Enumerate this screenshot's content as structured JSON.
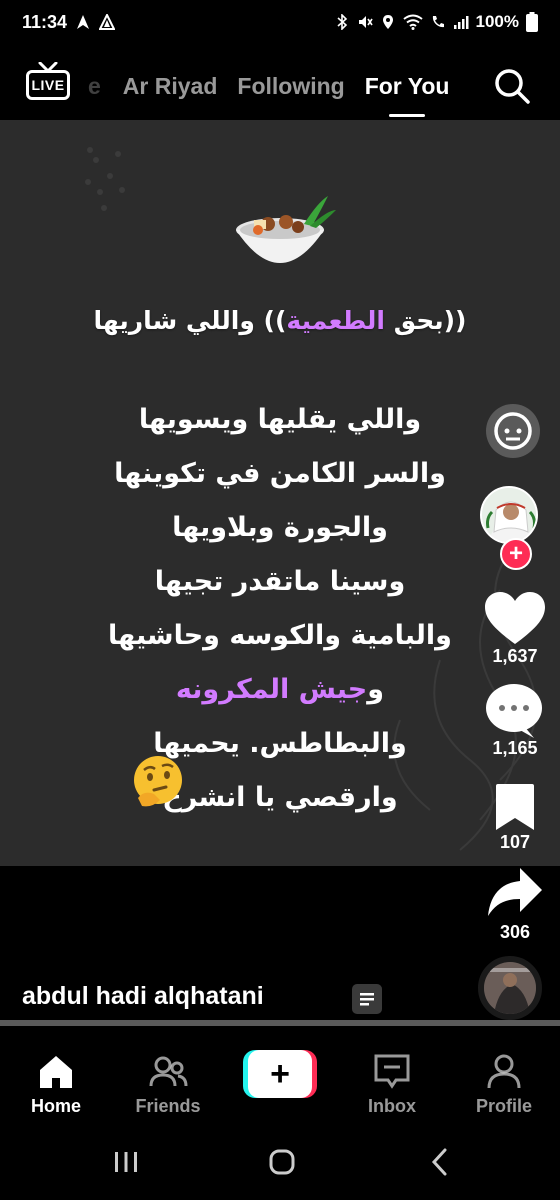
{
  "status_bar": {
    "time": "11:34",
    "battery": "100%"
  },
  "top_nav": {
    "live_label": "LIVE",
    "tabs": [
      {
        "label": "e"
      },
      {
        "label": "Ar Riyad"
      },
      {
        "label": "Following"
      },
      {
        "label": "For You"
      }
    ],
    "active_tab": "For You"
  },
  "video": {
    "background_color": "#2c2c2c",
    "caption_line1_part1": "((بحق ",
    "caption_line1_highlight": "الطعمية",
    "caption_line1_part2": ")) واللي شاريها",
    "poem_lines": [
      "واللي يقليها ويسويها",
      "والسر الكامن في تكوينها",
      "والجورة وبلاويها",
      "وسينا ماتقدر تجيها",
      "والبامية والكوسه وحاشيها"
    ],
    "highlight_line_prefix": "و",
    "highlight_line_purple": "جيش المكرونه",
    "poem_lines_after": [
      "والبطاطس. يحميها",
      "وارقصي يا انشرح"
    ],
    "highlight_color": "#d27bff"
  },
  "right_rail": {
    "likes": "1,637",
    "comments": "1,165",
    "saves": "107",
    "shares": "306"
  },
  "author": {
    "username": "abdul hadi alqhatani"
  },
  "bottom_nav": {
    "items": [
      {
        "label": "Home",
        "icon": "home-icon"
      },
      {
        "label": "Friends",
        "icon": "friends-icon"
      },
      {
        "label": "Inbox",
        "icon": "inbox-icon"
      },
      {
        "label": "Profile",
        "icon": "profile-icon"
      }
    ],
    "active": "Home"
  },
  "colors": {
    "accent_red": "#fe2c55",
    "accent_cyan": "#25f4ee"
  }
}
